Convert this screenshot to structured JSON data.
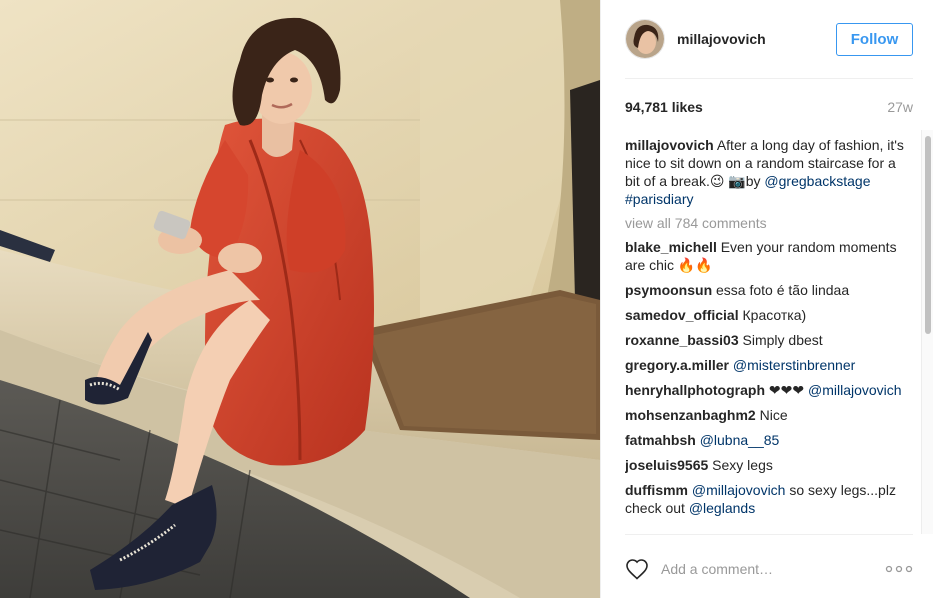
{
  "post": {
    "photo_alt": "Photo by millajovovich",
    "header": {
      "username": "millajovovich",
      "follow_label": "Follow"
    },
    "likes": "94,781 likes",
    "age": "27w",
    "caption": {
      "username": "millajovovich",
      "text": " After a long day of fashion, it's nice to sit down on a random staircase for a bit of a break.😉 📷by ",
      "mention": "@gregbackstage",
      "hashtag": "#parisdiary"
    },
    "view_all": "view all 784 comments",
    "comments": [
      {
        "user": "blake_michell",
        "text": " Even your random moments are chic 🔥🔥",
        "link": ""
      },
      {
        "user": "psymoonsun",
        "text": " essa foto é tão lindaa",
        "link": ""
      },
      {
        "user": "samedov_official",
        "text": " Красотка)",
        "link": ""
      },
      {
        "user": "roxanne_bassi03",
        "text": " Simply dbest",
        "link": ""
      },
      {
        "user": "gregory.a.miller",
        "text": " ",
        "link": "@misterstinbrenner"
      },
      {
        "user": "henryhallphotograph",
        "text": " ❤❤❤ ",
        "link": "@millajovovich"
      },
      {
        "user": "mohsenzanbaghm2",
        "text": " Nice",
        "link": ""
      },
      {
        "user": "fatmahbsh",
        "text": " ",
        "link": "@lubna__85"
      },
      {
        "user": "joseluis9565",
        "text": " Sexy legs",
        "link": ""
      },
      {
        "user": "duffismm",
        "text": " ",
        "link": "@millajovovich",
        "after": " so sexy legs...plz check out ",
        "link2": "@leglands"
      }
    ],
    "add_comment_placeholder": "Add a comment…",
    "colors": {
      "accent": "#3897f0",
      "link": "#003569",
      "muted": "#999999",
      "text": "#262626"
    },
    "icons": [
      "heart-icon",
      "more-options-icon"
    ]
  }
}
